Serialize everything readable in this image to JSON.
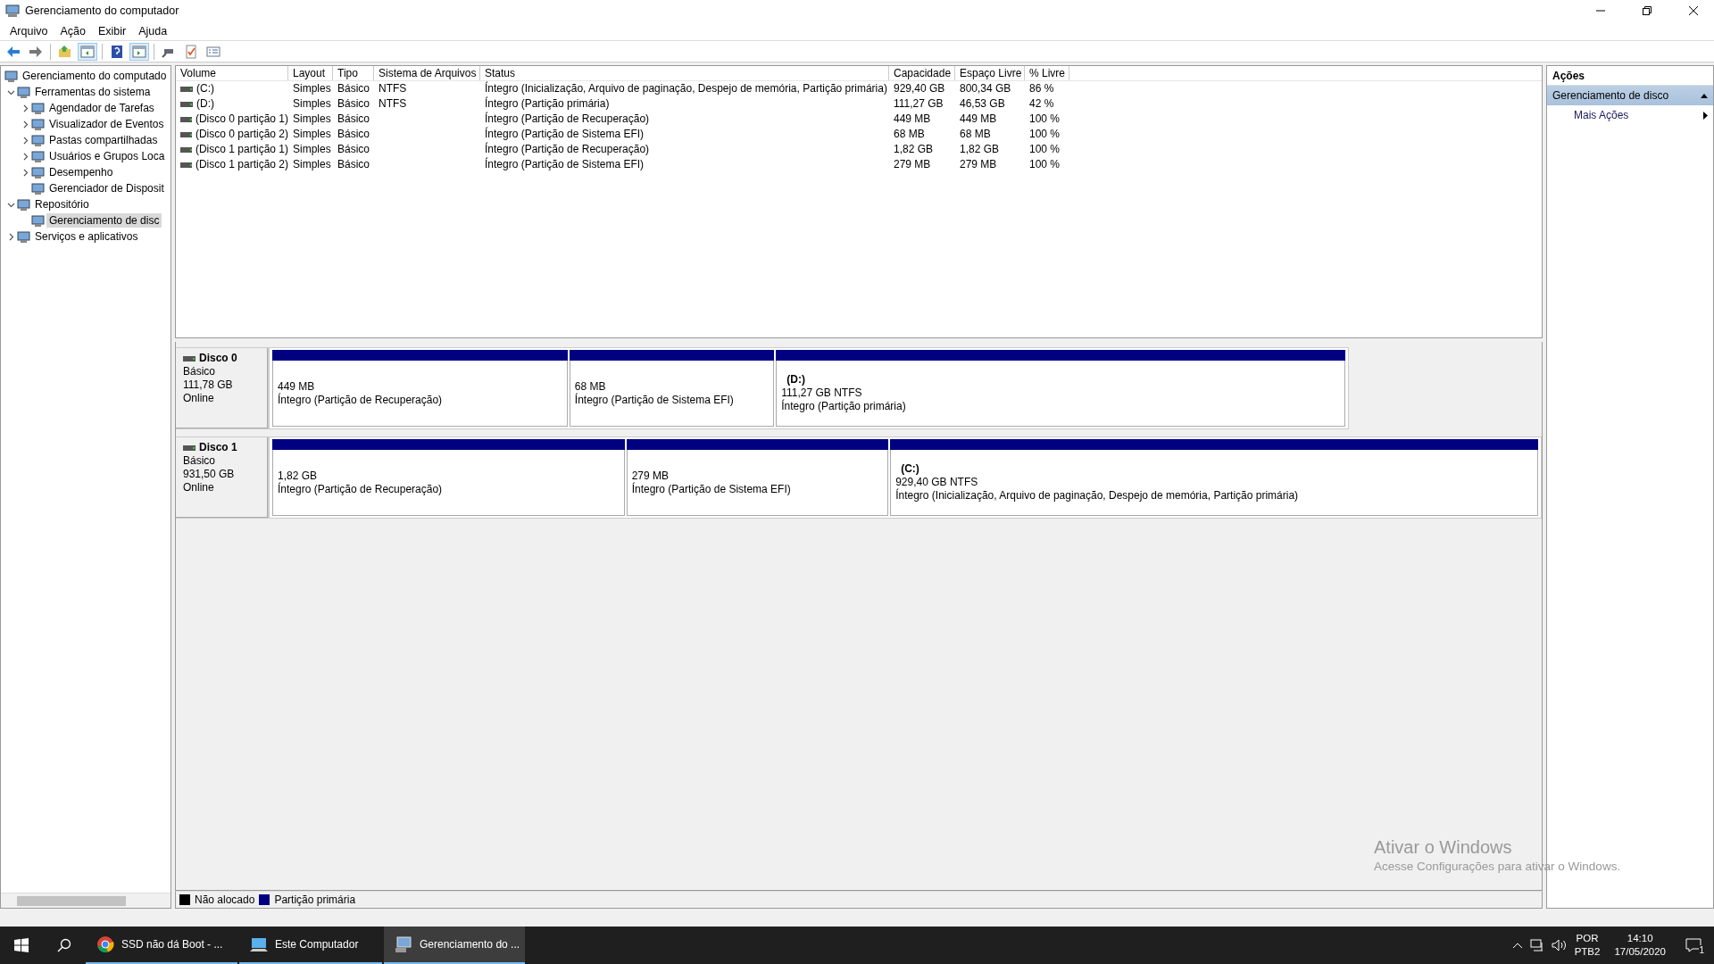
{
  "window": {
    "title": "Gerenciamento do computador"
  },
  "menu": [
    "Arquivo",
    "Ação",
    "Exibir",
    "Ajuda"
  ],
  "toolbar": [
    {
      "kind": "back",
      "pressed": false
    },
    {
      "kind": "forward",
      "pressed": false
    },
    {
      "kind": "sep"
    },
    {
      "kind": "up",
      "pressed": false
    },
    {
      "kind": "tree",
      "pressed": true
    },
    {
      "kind": "sep"
    },
    {
      "kind": "help",
      "pressed": false
    },
    {
      "kind": "actions",
      "pressed": true
    },
    {
      "kind": "sep"
    },
    {
      "kind": "connect",
      "pressed": false
    },
    {
      "kind": "check",
      "pressed": false
    },
    {
      "kind": "list",
      "pressed": false
    }
  ],
  "tree": {
    "label": "Gerenciamento do computado",
    "selected": false,
    "children": [
      {
        "label": "Ferramentas do sistema",
        "expanded": true,
        "selected": false,
        "children": [
          {
            "label": "Agendador de Tarefas",
            "expanded": false,
            "selected": false
          },
          {
            "label": "Visualizador de Eventos",
            "expanded": false,
            "selected": false
          },
          {
            "label": "Pastas compartilhadas",
            "expanded": false,
            "selected": false
          },
          {
            "label": "Usuários e Grupos Loca",
            "expanded": false,
            "selected": false
          },
          {
            "label": "Desempenho",
            "expanded": false,
            "selected": false
          },
          {
            "label": "Gerenciador de Disposit",
            "selected": false
          }
        ]
      },
      {
        "label": "Repositório",
        "expanded": true,
        "selected": false,
        "children": [
          {
            "label": "Gerenciamento de disc",
            "selected": true
          }
        ]
      },
      {
        "label": "Serviços e aplicativos",
        "expanded": false,
        "selected": false
      }
    ]
  },
  "table": {
    "columns": [
      "Volume",
      "Layout",
      "Tipo",
      "Sistema de Arquivos",
      "Status",
      "Capacidade",
      "Espaço Livre",
      "% Livre"
    ],
    "rows": [
      [
        "(C:)",
        "Simples",
        "Básico",
        "NTFS",
        "Íntegro (Inicialização, Arquivo de paginação, Despejo de memória, Partição primária)",
        "929,40 GB",
        "800,34 GB",
        "86 %"
      ],
      [
        "(D:)",
        "Simples",
        "Básico",
        "NTFS",
        "Íntegro (Partição primária)",
        "111,27 GB",
        "46,53 GB",
        "42 %"
      ],
      [
        "(Disco 0 partição 1)",
        "Simples",
        "Básico",
        "",
        "Íntegro (Partição de Recuperação)",
        "449 MB",
        "449 MB",
        "100 %"
      ],
      [
        "(Disco 0 partição 2)",
        "Simples",
        "Básico",
        "",
        "Íntegro (Partição de Sistema EFI)",
        "68 MB",
        "68 MB",
        "100 %"
      ],
      [
        "(Disco 1 partição 1)",
        "Simples",
        "Básico",
        "",
        "Íntegro (Partição de Recuperação)",
        "1,82 GB",
        "1,82 GB",
        "100 %"
      ],
      [
        "(Disco 1 partição 2)",
        "Simples",
        "Básico",
        "",
        "Íntegro (Partição de Sistema EFI)",
        "279 MB",
        "279 MB",
        "100 %"
      ]
    ]
  },
  "disks": [
    {
      "name": "Disco 0",
      "type": "Básico",
      "size": "111,78 GB",
      "status": "Online",
      "partitions": [
        {
          "size": "449 MB",
          "status": "Íntegro (Partição de Recuperação)"
        },
        {
          "size": "68 MB",
          "status": "Íntegro (Partição de Sistema EFI)"
        },
        {
          "letter": "(D:)",
          "size": "111,27 GB NTFS",
          "status": "Íntegro (Partição primária)"
        }
      ]
    },
    {
      "name": "Disco 1",
      "type": "Básico",
      "size": "931,50 GB",
      "status": "Online",
      "partitions": [
        {
          "size": "1,82 GB",
          "status": "Íntegro (Partição de Recuperação)"
        },
        {
          "size": "279 MB",
          "status": "Íntegro (Partição de Sistema EFI)"
        },
        {
          "letter": "(C:)",
          "size": "929,40 GB NTFS",
          "status": "Íntegro (Inicialização, Arquivo de paginação, Despejo de memória, Partição primária)"
        }
      ]
    }
  ],
  "legend": [
    {
      "label": "Não alocado",
      "color": "#000000"
    },
    {
      "label": "Partição primária",
      "color": "#000080"
    }
  ],
  "actions": {
    "title": "Ações",
    "section": "Gerenciamento de disco",
    "items": [
      "Mais Ações"
    ]
  },
  "activation_notice": {
    "title": "Ativar o Windows",
    "text": "Acesse Configurações para ativar o Windows."
  },
  "taskbar": {
    "apps": [
      {
        "kind": "browser",
        "label": "SSD não dá Boot - ...",
        "active": false
      },
      {
        "kind": "computer",
        "label": "Este Computador",
        "active": false
      },
      {
        "kind": "mmc",
        "label": "Gerenciamento do ...",
        "active": true
      }
    ],
    "language": "POR",
    "layout": "PTB2",
    "time": "14:10",
    "date": "17/05/2020",
    "notifications": "1"
  }
}
